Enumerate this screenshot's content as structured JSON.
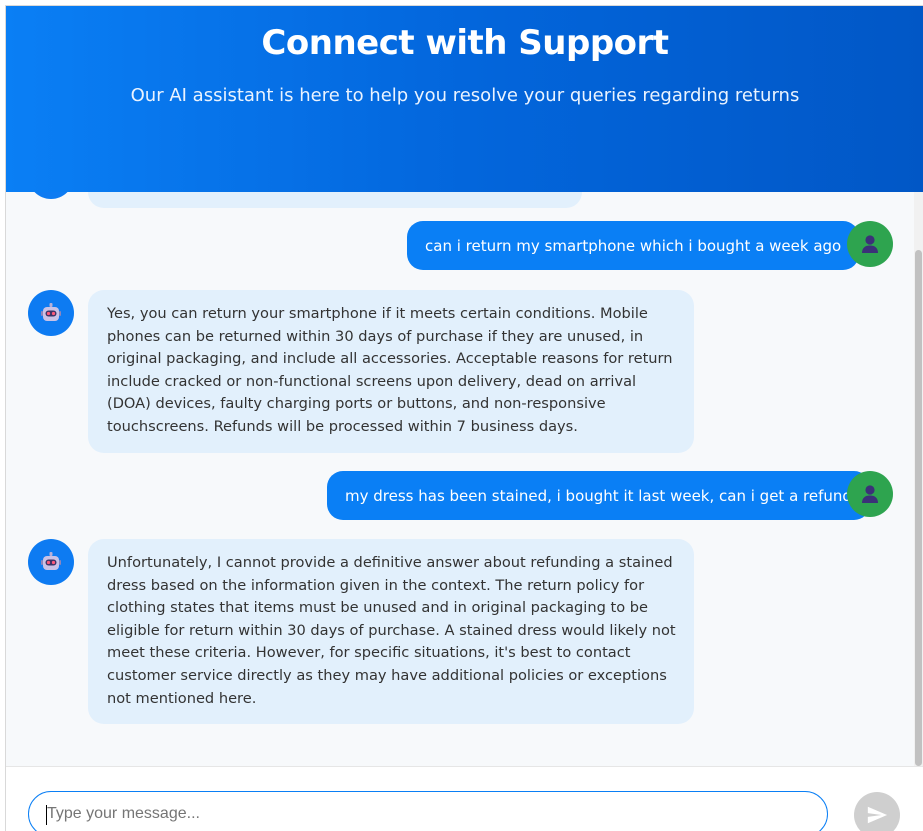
{
  "header": {
    "title": "Connect with Support",
    "subtitle": "Our AI assistant is here to help you resolve your queries regarding returns"
  },
  "messages": [
    {
      "role": "bot",
      "text": ""
    },
    {
      "role": "user",
      "text": "can i return my smartphone which i bought a week ago"
    },
    {
      "role": "bot",
      "text": "Yes, you can return your smartphone if it meets certain conditions. Mobile phones can be returned within 30 days of purchase if they are unused, in original packaging, and include all accessories. Acceptable reasons for return include cracked or non-functional screens upon delivery, dead on arrival (DOA) devices, faulty charging ports or buttons, and non-responsive touchscreens. Refunds will be processed within 7 business days."
    },
    {
      "role": "user",
      "text": "my dress has been stained, i bought it last week, can i get a refund"
    },
    {
      "role": "bot",
      "text": "Unfortunately, I cannot provide a definitive answer about refunding a stained dress based on the information given in the context. The return policy for clothing states that items must be unused and in original packaging to be eligible for return within 30 days of purchase. A stained dress would likely not meet these criteria. However, for specific situations, it's best to contact customer service directly as they may have additional policies or exceptions not mentioned here."
    }
  ],
  "composer": {
    "placeholder": "Type your message...",
    "value": ""
  },
  "icons": {
    "bot_avatar": "robot-icon",
    "user_avatar": "person-icon",
    "send": "send-icon"
  },
  "colors": {
    "primary": "#0a7ff5",
    "bot_bubble": "#e2f0fc",
    "user_avatar": "#2ea44f",
    "send_disabled": "#cfcfcf"
  }
}
